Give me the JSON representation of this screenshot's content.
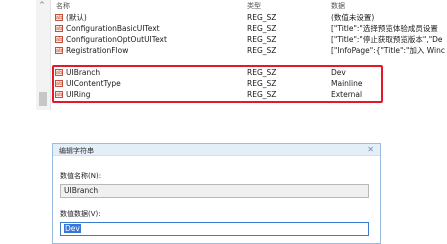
{
  "list_header": {
    "name": "名称",
    "type": "类型",
    "data": "数据"
  },
  "rows": [
    {
      "name": "(默认)",
      "type": "REG_SZ",
      "data": "(数值未设置)"
    },
    {
      "name": "ConfigurationBasicUIText",
      "type": "REG_SZ",
      "data": "[\"Title\":\"选择预览体验成员设置"
    },
    {
      "name": "ConfigurationOptOutUIText",
      "type": "REG_SZ",
      "data": "[\"Title\":\"停止获取预览版本\",\"De"
    },
    {
      "name": "RegistrationFlow",
      "type": "REG_SZ",
      "data": "[\"InfoPage\":{\"Title\":\"加入 Winc"
    },
    {
      "name": "UIBranch",
      "type": "REG_SZ",
      "data": "Dev"
    },
    {
      "name": "UIContentType",
      "type": "REG_SZ",
      "data": "Mainline"
    },
    {
      "name": "UIRing",
      "type": "REG_SZ",
      "data": "External"
    }
  ],
  "dialog": {
    "title": "编辑字符串",
    "close_glyph": "✕",
    "value_name_label": "数值名称(N):",
    "value_name": "UIBranch",
    "value_data_label": "数值数据(V):",
    "value_data": "Dev"
  },
  "icons": {
    "string_value": "ab-string-icon"
  },
  "colors": {
    "highlight": "#e3192a",
    "selection": "#3875d7"
  }
}
